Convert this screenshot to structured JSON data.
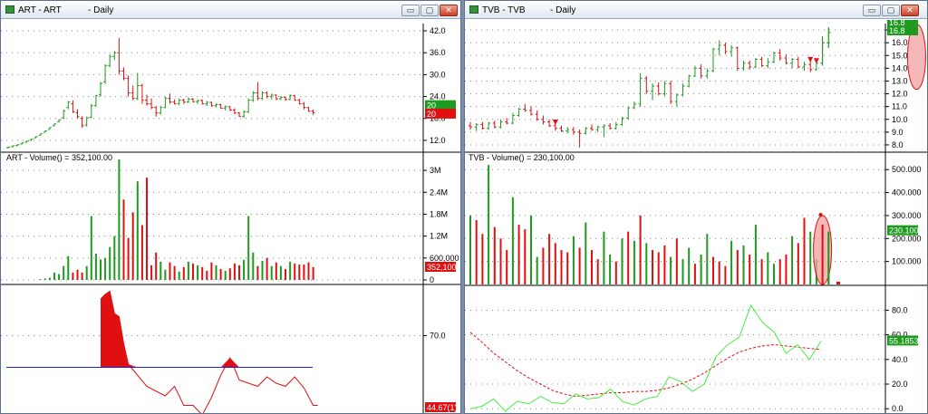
{
  "left_window": {
    "title": "ART - ART",
    "period": "- Daily",
    "volume_label": "ART - Volume() = 352,100.00"
  },
  "right_window": {
    "title": "TVB - TVB",
    "period": "- Daily",
    "volume_label": "TVB - Volume() = 230,100.00"
  },
  "window_buttons": {
    "minimize": "▭",
    "restore": "▢",
    "close": "✕"
  },
  "colors": {
    "up": "#1e9a1e",
    "down": "#e01010",
    "accent_line": "#2222cc",
    "oscillator_up": "#44ee44",
    "highlight": "#f2a0a0"
  },
  "chart_data": [
    {
      "name_key": "ART price",
      "type": "candlestick",
      "ylim": [
        9,
        44
      ],
      "yticks": [
        12,
        18,
        24,
        30,
        36,
        42
      ],
      "ytick_labels": [
        "12.0",
        "18.0",
        "24.0",
        "30.0",
        "36.0",
        "42.0"
      ],
      "last_up_label": "20",
      "last_down_label": "20",
      "candles": [
        [
          10.0,
          10.2,
          9.8,
          10.1
        ],
        [
          10.3,
          10.6,
          10.1,
          10.5
        ],
        [
          10.6,
          10.9,
          10.4,
          10.8
        ],
        [
          11.0,
          11.4,
          10.9,
          11.3
        ],
        [
          11.5,
          11.9,
          11.4,
          11.8
        ],
        [
          12.0,
          12.4,
          11.9,
          12.3
        ],
        [
          12.7,
          13.1,
          12.6,
          13.0
        ],
        [
          13.4,
          13.9,
          13.3,
          13.8
        ],
        [
          14.2,
          14.7,
          14.1,
          14.6
        ],
        [
          15.0,
          15.6,
          14.9,
          15.5
        ],
        [
          16.0,
          16.6,
          15.8,
          16.5
        ],
        [
          17.1,
          17.8,
          16.9,
          17.6
        ],
        [
          18.2,
          20.4,
          17.8,
          20.0
        ],
        [
          21.0,
          22.8,
          20.5,
          22.5
        ],
        [
          22.0,
          23.0,
          19.5,
          19.8
        ],
        [
          19.6,
          20.5,
          18.0,
          18.5
        ],
        [
          18.0,
          18.6,
          15.5,
          16.0
        ],
        [
          16.2,
          18.5,
          15.8,
          18.2
        ],
        [
          18.3,
          22.0,
          18.0,
          21.5
        ],
        [
          21.5,
          24.5,
          21.2,
          24.2
        ],
        [
          24.5,
          28.0,
          24.0,
          27.6
        ],
        [
          28.0,
          32.8,
          27.5,
          32.5
        ],
        [
          32.5,
          35.5,
          32.0,
          35.0
        ],
        [
          35.0,
          36.5,
          34.0,
          36.0
        ],
        [
          36.0,
          40.0,
          30.0,
          31.0
        ],
        [
          31.0,
          32.0,
          28.5,
          29.0
        ],
        [
          29.0,
          29.8,
          24.0,
          25.0
        ],
        [
          25.0,
          27.0,
          23.0,
          23.5
        ],
        [
          23.5,
          30.5,
          23.0,
          27.0
        ],
        [
          27.0,
          27.5,
          22.0,
          23.0
        ],
        [
          23.0,
          24.5,
          21.5,
          22.0
        ],
        [
          22.0,
          23.5,
          20.5,
          21.0
        ],
        [
          21.0,
          21.5,
          18.5,
          19.5
        ],
        [
          19.5,
          21.5,
          19.0,
          21.0
        ],
        [
          21.0,
          24.0,
          20.8,
          23.5
        ],
        [
          23.5,
          24.8,
          22.0,
          22.5
        ],
        [
          22.5,
          23.2,
          21.8,
          22.0
        ],
        [
          22.0,
          23.5,
          21.6,
          23.0
        ],
        [
          23.0,
          23.4,
          22.0,
          22.5
        ],
        [
          22.5,
          23.8,
          22.2,
          23.3
        ],
        [
          23.3,
          23.6,
          22.4,
          22.6
        ],
        [
          22.6,
          23.2,
          22.0,
          22.9
        ],
        [
          22.9,
          23.2,
          21.8,
          22.0
        ],
        [
          22.0,
          22.8,
          21.4,
          22.4
        ],
        [
          22.4,
          22.6,
          21.2,
          21.5
        ],
        [
          21.5,
          22.2,
          21.0,
          21.8
        ],
        [
          21.8,
          22.0,
          20.6,
          20.8
        ],
        [
          20.8,
          21.6,
          20.2,
          21.2
        ],
        [
          21.2,
          21.4,
          20.0,
          20.3
        ],
        [
          20.3,
          20.8,
          19.2,
          19.5
        ],
        [
          19.5,
          19.8,
          18.4,
          18.6
        ],
        [
          18.6,
          20.2,
          18.2,
          19.8
        ],
        [
          19.8,
          23.5,
          19.5,
          23.0
        ],
        [
          23.0,
          25.5,
          22.5,
          25.0
        ],
        [
          25.0,
          28.0,
          23.0,
          23.5
        ],
        [
          23.5,
          25.5,
          23.0,
          25.0
        ],
        [
          25.0,
          25.4,
          23.5,
          24.0
        ],
        [
          24.0,
          24.8,
          23.2,
          24.4
        ],
        [
          24.4,
          24.6,
          23.0,
          23.4
        ],
        [
          23.4,
          24.2,
          23.0,
          23.8
        ],
        [
          23.8,
          24.0,
          22.8,
          23.2
        ],
        [
          23.2,
          24.6,
          23.0,
          24.2
        ],
        [
          24.2,
          24.5,
          22.8,
          23.0
        ],
        [
          23.0,
          23.4,
          21.8,
          22.0
        ],
        [
          22.0,
          22.5,
          20.5,
          21.0
        ],
        [
          21.0,
          21.2,
          19.8,
          20.0
        ],
        [
          20.0,
          20.4,
          19.0,
          19.6
        ]
      ]
    },
    {
      "name_key": "ART volume",
      "type": "bar",
      "ylim": [
        0,
        3300000
      ],
      "yticks": [
        0,
        600000,
        1200000,
        1800000,
        2400000,
        3000000
      ],
      "ytick_labels": [
        "0",
        "600,000",
        "1.2M",
        "1.8M",
        "2.4M",
        "3M"
      ],
      "last_label": "352,100",
      "values": [
        0,
        0,
        0,
        0,
        0,
        0,
        0,
        20000,
        40000,
        60000,
        200000,
        160000,
        380000,
        650000,
        200000,
        280000,
        200000,
        380000,
        1750000,
        720000,
        560000,
        600000,
        900000,
        1200000,
        3300000,
        2200000,
        1150000,
        1850000,
        2700000,
        1500000,
        2800000,
        400000,
        750000,
        500000,
        280000,
        480000,
        380000,
        230000,
        350000,
        500000,
        450000,
        400000,
        350000,
        250000,
        480000,
        400000,
        300000,
        250000,
        320000,
        450000,
        400000,
        550000,
        1750000,
        750000,
        380000,
        520000,
        600000,
        380000,
        480000,
        380000,
        300000,
        500000,
        450000,
        420000,
        420000,
        480000,
        352100
      ],
      "up": [
        1,
        1,
        1,
        1,
        1,
        1,
        1,
        1,
        1,
        1,
        1,
        1,
        1,
        1,
        0,
        0,
        0,
        1,
        1,
        1,
        1,
        1,
        1,
        1,
        1,
        0,
        0,
        0,
        1,
        0,
        0,
        0,
        0,
        1,
        1,
        0,
        0,
        1,
        0,
        1,
        0,
        1,
        0,
        0,
        0,
        1,
        0,
        1,
        0,
        0,
        0,
        1,
        1,
        1,
        0,
        1,
        0,
        1,
        0,
        1,
        0,
        1,
        0,
        0,
        0,
        0,
        0
      ]
    },
    {
      "name_key": "ART oscillator",
      "type": "line",
      "ylim": [
        20,
        100
      ],
      "yticks": [
        70
      ],
      "ytick_labels": [
        "70.0"
      ],
      "threshold": 50,
      "last_label": "44.67(1)",
      "x": [
        0,
        5,
        10,
        15,
        18,
        20,
        21,
        22,
        23,
        24,
        25,
        26,
        28,
        30,
        32,
        34,
        36,
        38,
        40,
        42,
        44,
        46,
        48,
        50,
        52,
        54,
        56,
        58,
        60,
        62,
        64,
        66,
        67
      ],
      "values": [
        null,
        null,
        null,
        null,
        null,
        93,
        96,
        98,
        84,
        82,
        65,
        52,
        45,
        38,
        35,
        32,
        38,
        26,
        26,
        20,
        31,
        45,
        56,
        42,
        40,
        38,
        44,
        40,
        38,
        44,
        37,
        26,
        26
      ]
    },
    {
      "name_key": "TVB price",
      "type": "candlestick",
      "ylim": [
        7.5,
        17.5
      ],
      "yticks": [
        8,
        9,
        10,
        11,
        12,
        13,
        14,
        15,
        16,
        17
      ],
      "ytick_labels": [
        "8.0",
        "9.0",
        "10.0",
        "11.0",
        "12.0",
        "13.0",
        "14.0",
        "15.0",
        "16.0",
        "17.0"
      ],
      "last_up_label": "16.8",
      "last_down_label": "16.8",
      "signal_arrows_x": [
        14,
        56,
        57
      ],
      "highlight_range": [
        72,
        74
      ],
      "candles": [
        [
          9.5,
          9.8,
          9.2,
          9.4
        ],
        [
          9.4,
          9.7,
          9.1,
          9.6
        ],
        [
          9.6,
          9.8,
          9.2,
          9.3
        ],
        [
          9.3,
          9.8,
          9.2,
          9.7
        ],
        [
          9.7,
          9.9,
          9.3,
          9.4
        ],
        [
          9.4,
          10.0,
          9.3,
          9.8
        ],
        [
          9.8,
          10.1,
          9.6,
          9.7
        ],
        [
          9.7,
          10.5,
          9.6,
          10.3
        ],
        [
          10.3,
          10.9,
          10.2,
          10.8
        ],
        [
          10.8,
          11.2,
          10.6,
          10.7
        ],
        [
          10.7,
          11.0,
          10.3,
          10.4
        ],
        [
          10.4,
          10.7,
          9.9,
          10.0
        ],
        [
          10.0,
          10.3,
          9.6,
          9.8
        ],
        [
          9.8,
          10.0,
          9.4,
          9.5
        ],
        [
          9.5,
          9.7,
          9.1,
          9.3
        ],
        [
          9.3,
          9.5,
          9.0,
          9.1
        ],
        [
          9.1,
          9.4,
          8.9,
          9.2
        ],
        [
          9.2,
          9.4,
          8.8,
          9.0
        ],
        [
          9.0,
          9.2,
          7.8,
          8.9
        ],
        [
          8.9,
          9.4,
          8.8,
          9.3
        ],
        [
          9.3,
          9.6,
          9.1,
          9.2
        ],
        [
          9.2,
          9.5,
          9.0,
          9.4
        ],
        [
          9.4,
          9.6,
          8.6,
          9.5
        ],
        [
          9.5,
          9.7,
          9.2,
          9.3
        ],
        [
          9.3,
          9.8,
          9.2,
          9.6
        ],
        [
          9.6,
          10.2,
          9.5,
          10.1
        ],
        [
          10.1,
          11.0,
          10.0,
          10.9
        ],
        [
          10.9,
          11.4,
          10.8,
          11.2
        ],
        [
          11.2,
          13.6,
          11.0,
          13.2
        ],
        [
          13.2,
          13.4,
          12.0,
          12.2
        ],
        [
          12.2,
          12.8,
          11.5,
          12.6
        ],
        [
          12.6,
          12.9,
          11.9,
          12.0
        ],
        [
          12.0,
          13.0,
          11.8,
          12.8
        ],
        [
          12.8,
          13.0,
          11.2,
          11.4
        ],
        [
          11.4,
          12.0,
          11.0,
          11.9
        ],
        [
          11.9,
          12.8,
          11.8,
          12.6
        ],
        [
          12.6,
          13.5,
          12.5,
          13.4
        ],
        [
          13.4,
          14.2,
          13.3,
          14.0
        ],
        [
          14.0,
          14.3,
          13.2,
          13.4
        ],
        [
          13.4,
          14.0,
          13.2,
          13.8
        ],
        [
          13.8,
          15.6,
          13.7,
          15.5
        ],
        [
          15.5,
          16.2,
          15.0,
          15.8
        ],
        [
          15.8,
          16.0,
          15.1,
          15.3
        ],
        [
          15.3,
          15.8,
          14.9,
          15.6
        ],
        [
          15.6,
          15.7,
          13.8,
          14.0
        ],
        [
          14.0,
          14.6,
          13.8,
          14.4
        ],
        [
          14.4,
          14.6,
          13.9,
          14.1
        ],
        [
          14.1,
          14.8,
          14.0,
          14.7
        ],
        [
          14.7,
          14.9,
          14.1,
          14.2
        ],
        [
          14.2,
          14.8,
          14.0,
          14.5
        ],
        [
          14.5,
          15.3,
          14.4,
          15.2
        ],
        [
          15.2,
          15.5,
          14.6,
          14.8
        ],
        [
          14.8,
          15.1,
          14.3,
          14.4
        ],
        [
          14.4,
          14.8,
          14.0,
          14.7
        ],
        [
          14.7,
          14.9,
          14.0,
          14.1
        ],
        [
          14.1,
          14.5,
          13.8,
          14.3
        ],
        [
          14.3,
          14.6,
          13.7,
          13.9
        ],
        [
          13.9,
          14.5,
          13.8,
          14.4
        ],
        [
          14.4,
          16.5,
          14.2,
          16.0
        ],
        [
          16.0,
          17.2,
          15.6,
          16.8
        ]
      ]
    },
    {
      "name_key": "TVB volume",
      "type": "bar",
      "ylim": [
        0,
        560000
      ],
      "yticks": [
        100000,
        200000,
        300000,
        400000,
        500000
      ],
      "ytick_labels": [
        "100.000",
        "200.000",
        "300.000",
        "400.000",
        "500.000"
      ],
      "last_label": "230.100",
      "values": [
        300000,
        280000,
        220000,
        520000,
        250000,
        200000,
        150000,
        380000,
        260000,
        240000,
        300000,
        120000,
        160000,
        220000,
        180000,
        150000,
        140000,
        210000,
        160000,
        270000,
        150000,
        110000,
        230000,
        130000,
        100000,
        200000,
        230000,
        190000,
        300000,
        180000,
        150000,
        140000,
        170000,
        120000,
        200000,
        110000,
        160000,
        90000,
        130000,
        220000,
        120000,
        100000,
        80000,
        190000,
        150000,
        170000,
        130000,
        260000,
        110000,
        140000,
        90000,
        110000,
        130000,
        210000,
        180000,
        290000,
        230000,
        110000,
        260000,
        230100
      ],
      "up": [
        1,
        0,
        0,
        1,
        0,
        0,
        0,
        1,
        0,
        0,
        1,
        1,
        0,
        0,
        0,
        0,
        0,
        1,
        0,
        1,
        0,
        0,
        1,
        1,
        0,
        1,
        0,
        1,
        0,
        1,
        0,
        0,
        0,
        1,
        0,
        1,
        1,
        0,
        1,
        1,
        0,
        0,
        0,
        1,
        0,
        1,
        0,
        1,
        0,
        1,
        1,
        0,
        0,
        1,
        0,
        0,
        1,
        1,
        0,
        1
      ]
    },
    {
      "name_key": "TVB oscillator",
      "type": "line",
      "ylim": [
        -5,
        95
      ],
      "yticks": [
        0,
        20,
        40,
        60,
        80
      ],
      "ytick_labels": [
        "0.0",
        "20.0",
        "40.0",
        "60.0",
        "80.0"
      ],
      "last_label": "55.1853",
      "x": [
        0,
        2,
        4,
        6,
        8,
        10,
        12,
        14,
        16,
        18,
        20,
        22,
        24,
        26,
        28,
        30,
        32,
        34,
        36,
        38,
        40,
        42,
        44,
        46,
        48,
        50,
        52,
        54,
        56,
        58,
        60
      ],
      "values": [
        0,
        2,
        8,
        -2,
        6,
        4,
        10,
        5,
        4,
        12,
        8,
        9,
        16,
        6,
        3,
        8,
        10,
        26,
        22,
        14,
        20,
        42,
        52,
        58,
        84,
        70,
        62,
        45,
        52,
        40,
        55
      ],
      "signal": [
        62,
        54,
        45,
        38,
        31,
        25,
        20,
        15,
        12,
        10,
        11,
        12,
        13,
        13,
        14,
        14,
        15,
        17,
        20,
        24,
        29,
        35,
        41,
        46,
        49,
        51,
        52,
        51,
        50,
        49,
        48
      ]
    }
  ]
}
